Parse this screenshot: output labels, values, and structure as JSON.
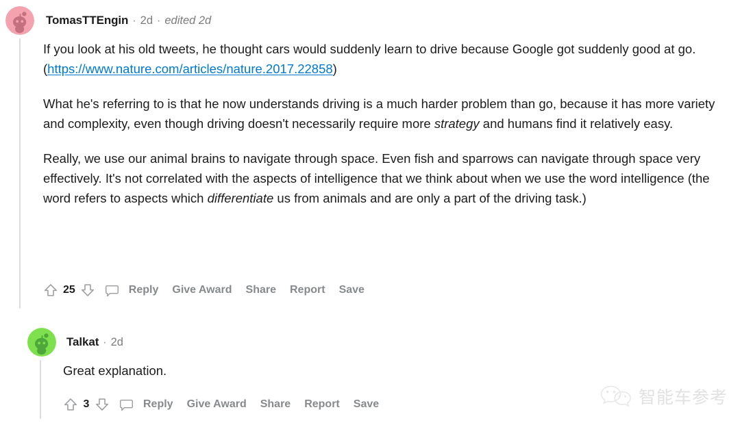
{
  "comments": [
    {
      "author": "TomasTTEngin",
      "timestamp": "2d",
      "edited": "edited 2d",
      "separator": "·",
      "avatar_bg": "#F4A2AE",
      "avatar_fg": "#C4707F",
      "score": "25",
      "paragraphs": [
        {
          "pre": "If you look at his old tweets, he thought cars would suddenly learn to drive because Google got suddenly good at go. (",
          "link": "https://www.nature.com/articles/nature.2017.22858",
          "post": ")"
        },
        {
          "pre": "What he's referring to is that he now understands driving is a much harder problem than go, because it has more variety and complexity, even though driving doesn't necessarily require more ",
          "italic": "strategy",
          "post": " and humans find it relatively easy."
        },
        {
          "pre": "Really, we use our animal brains to navigate through space. Even fish and sparrows can navigate through space very effectively. It's not correlated with the aspects of intelligence that we think about when we use the word intelligence (the word refers to aspects which ",
          "italic": "differentiate",
          "post": " us from animals and are only a part of the driving task.)"
        }
      ],
      "actions": [
        "Reply",
        "Give Award",
        "Share",
        "Report",
        "Save"
      ]
    },
    {
      "author": "Talkat",
      "timestamp": "2d",
      "edited": "",
      "separator": "·",
      "avatar_bg": "#7DE04C",
      "avatar_fg": "#4FA63A",
      "score": "3",
      "paragraphs": [
        {
          "pre": "Great explanation.",
          "italic": "",
          "post": ""
        }
      ],
      "actions": [
        "Reply",
        "Give Award",
        "Share",
        "Report",
        "Save"
      ]
    }
  ],
  "icons": {
    "upvote": "upvote-arrow-icon",
    "downvote": "downvote-arrow-icon",
    "comment_bubble": "comment-bubble-icon"
  },
  "watermark": {
    "text": "智能车参考",
    "logo": "wechat-logo-icon"
  },
  "colors": {
    "link": "#0079d3",
    "action_text": "#878a8c",
    "body_text": "#1c1c1c",
    "thread_line": "#dcdcdc"
  }
}
